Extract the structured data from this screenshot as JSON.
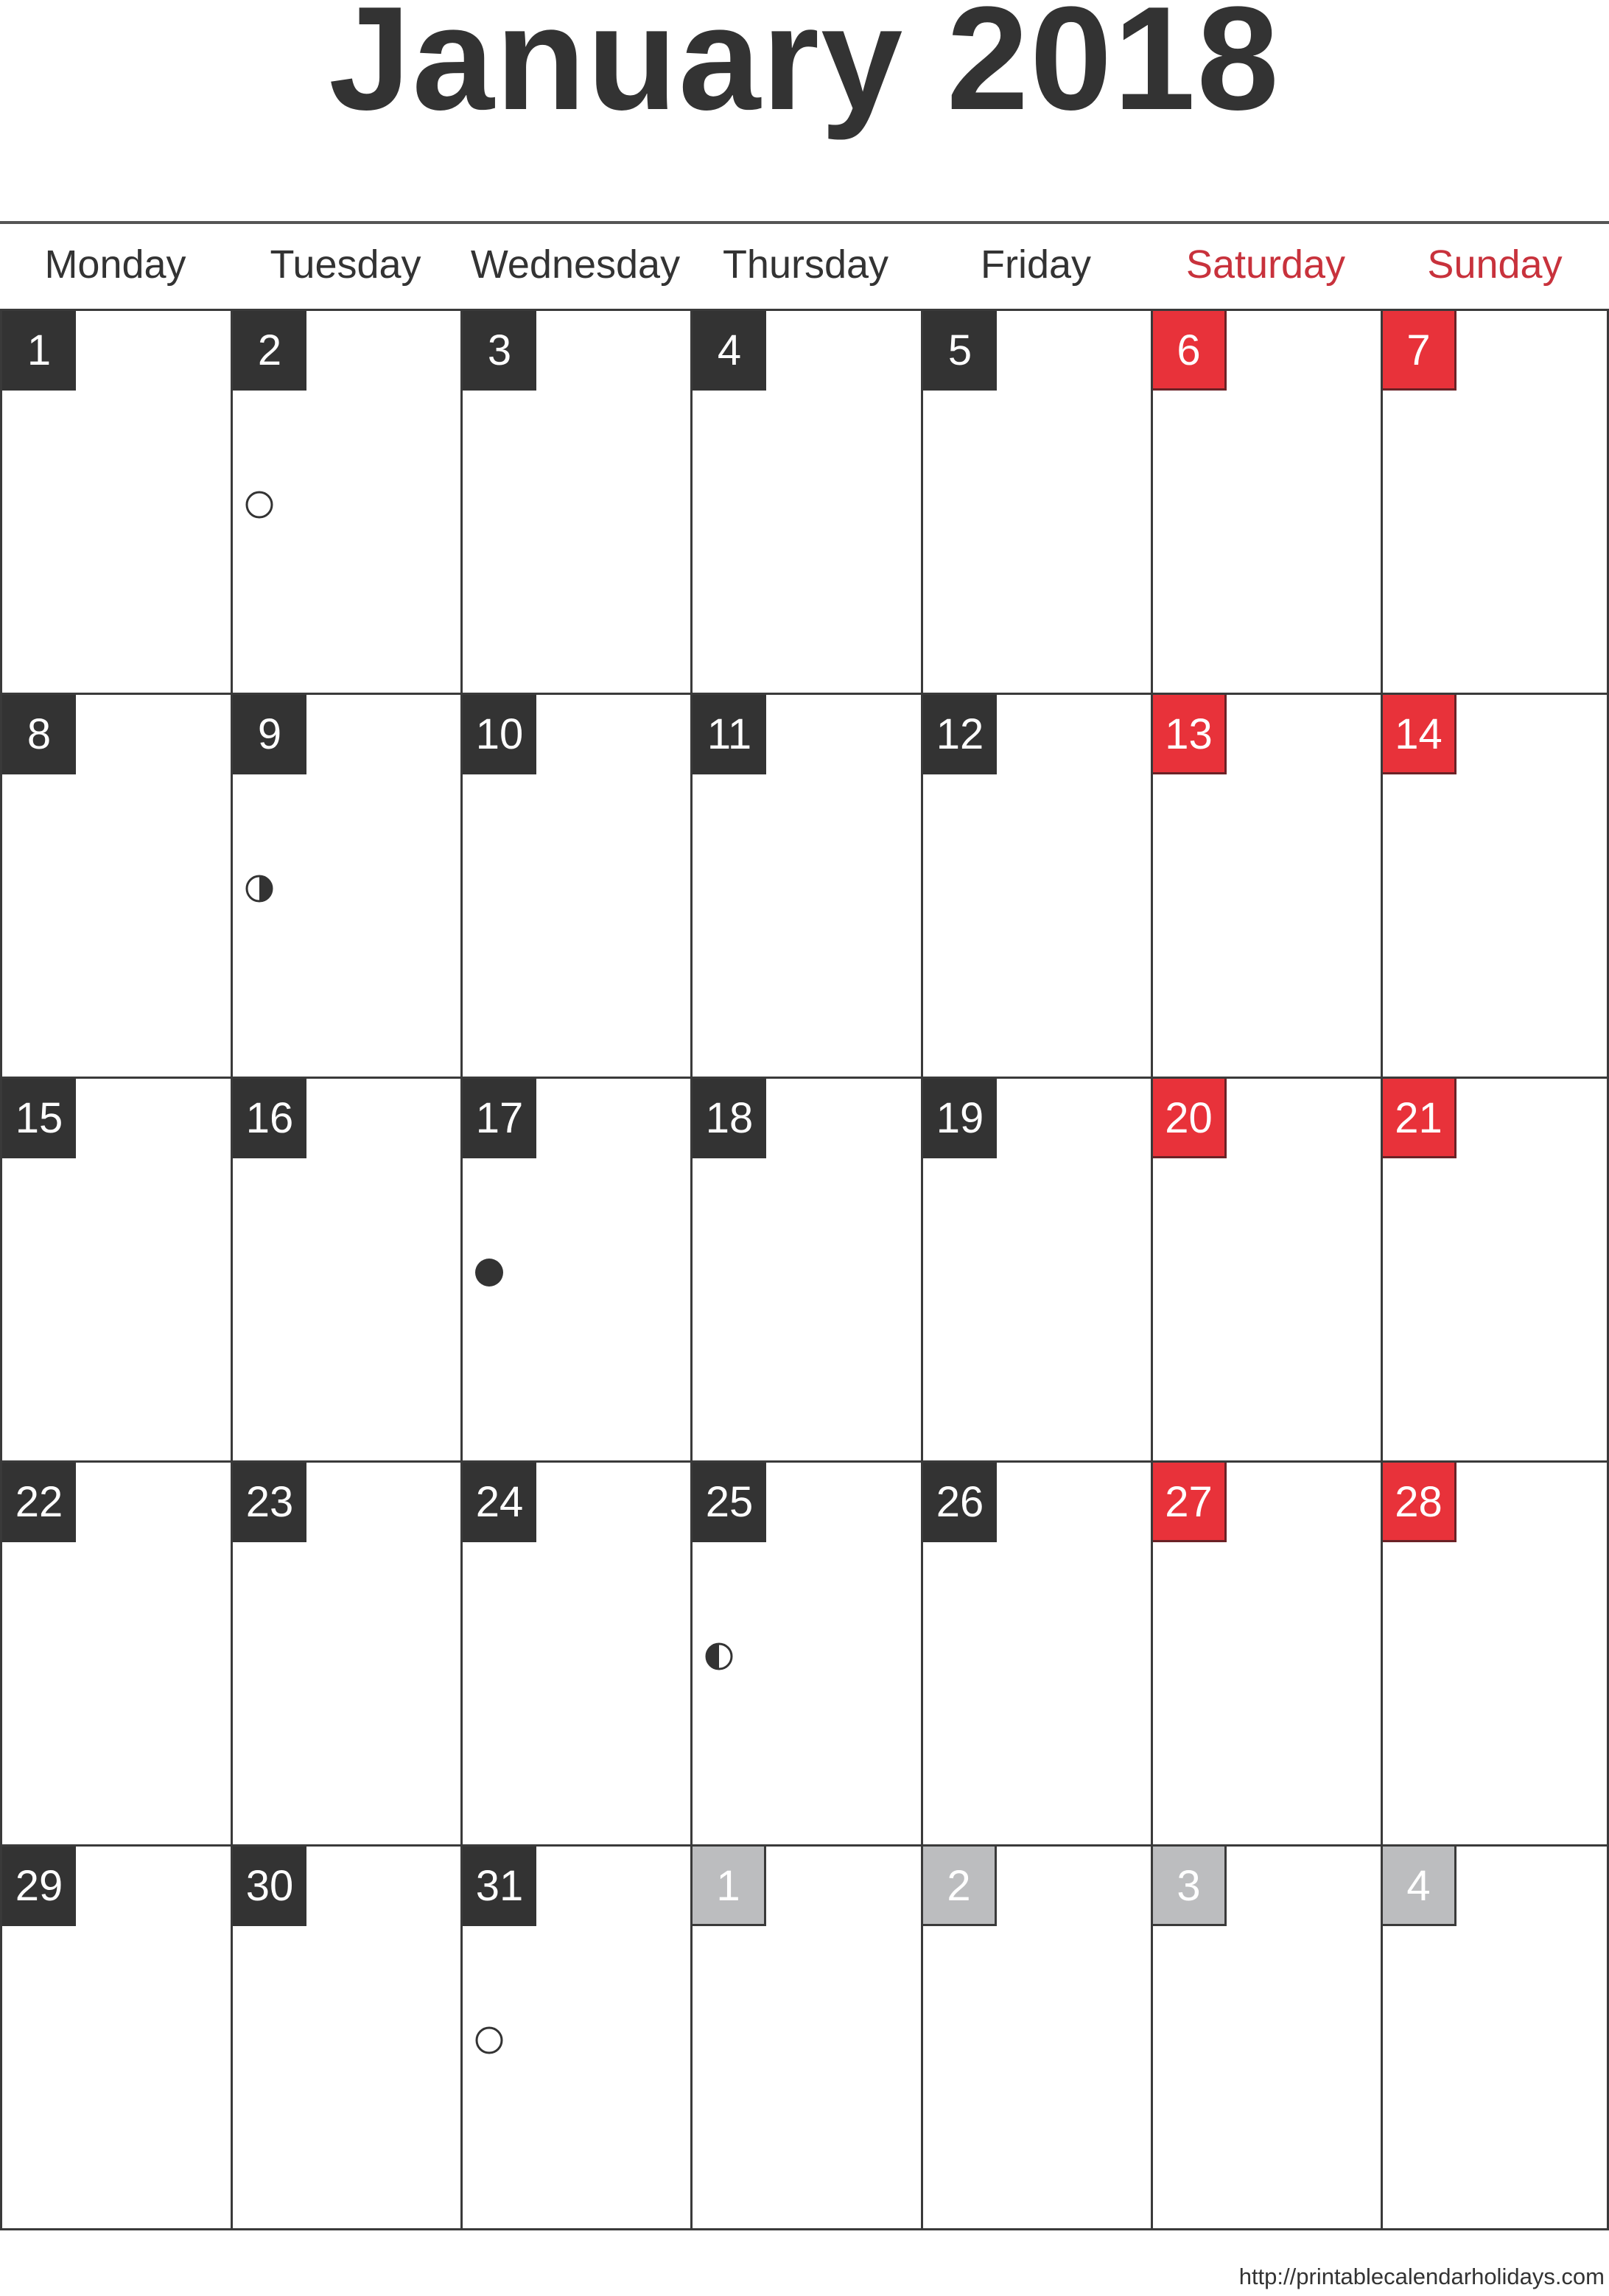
{
  "title": "January 2018",
  "weekdays": [
    {
      "label": "Monday",
      "weekend": false
    },
    {
      "label": "Tuesday",
      "weekend": false
    },
    {
      "label": "Wednesday",
      "weekend": false
    },
    {
      "label": "Thursday",
      "weekend": false
    },
    {
      "label": "Friday",
      "weekend": false
    },
    {
      "label": "Saturday",
      "weekend": true
    },
    {
      "label": "Sunday",
      "weekend": true
    }
  ],
  "weeks": [
    [
      {
        "day": "1",
        "type": "weekday"
      },
      {
        "day": "2",
        "type": "weekday",
        "moon": "full-moon"
      },
      {
        "day": "3",
        "type": "weekday"
      },
      {
        "day": "4",
        "type": "weekday"
      },
      {
        "day": "5",
        "type": "weekday"
      },
      {
        "day": "6",
        "type": "weekend"
      },
      {
        "day": "7",
        "type": "weekend"
      }
    ],
    [
      {
        "day": "8",
        "type": "weekday"
      },
      {
        "day": "9",
        "type": "weekday",
        "moon": "last-quarter"
      },
      {
        "day": "10",
        "type": "weekday"
      },
      {
        "day": "11",
        "type": "weekday"
      },
      {
        "day": "12",
        "type": "weekday"
      },
      {
        "day": "13",
        "type": "weekend"
      },
      {
        "day": "14",
        "type": "weekend"
      }
    ],
    [
      {
        "day": "15",
        "type": "weekday"
      },
      {
        "day": "16",
        "type": "weekday"
      },
      {
        "day": "17",
        "type": "weekday",
        "moon": "new-moon"
      },
      {
        "day": "18",
        "type": "weekday"
      },
      {
        "day": "19",
        "type": "weekday"
      },
      {
        "day": "20",
        "type": "weekend"
      },
      {
        "day": "21",
        "type": "weekend"
      }
    ],
    [
      {
        "day": "22",
        "type": "weekday"
      },
      {
        "day": "23",
        "type": "weekday"
      },
      {
        "day": "24",
        "type": "weekday"
      },
      {
        "day": "25",
        "type": "weekday",
        "moon": "first-quarter"
      },
      {
        "day": "26",
        "type": "weekday"
      },
      {
        "day": "27",
        "type": "weekend"
      },
      {
        "day": "28",
        "type": "weekend"
      }
    ],
    [
      {
        "day": "29",
        "type": "weekday"
      },
      {
        "day": "30",
        "type": "weekday"
      },
      {
        "day": "31",
        "type": "weekday",
        "moon": "full-moon"
      },
      {
        "day": "1",
        "type": "other"
      },
      {
        "day": "2",
        "type": "other"
      },
      {
        "day": "3",
        "type": "other"
      },
      {
        "day": "4",
        "type": "other"
      }
    ]
  ],
  "colors": {
    "text": "#333333",
    "weekend_text": "#c8323c",
    "weekday_badge": "#333333",
    "weekend_badge": "#e8323a",
    "other_month_badge": "#bcbdbf"
  },
  "footer": "http://printablecalendarholidays.com"
}
